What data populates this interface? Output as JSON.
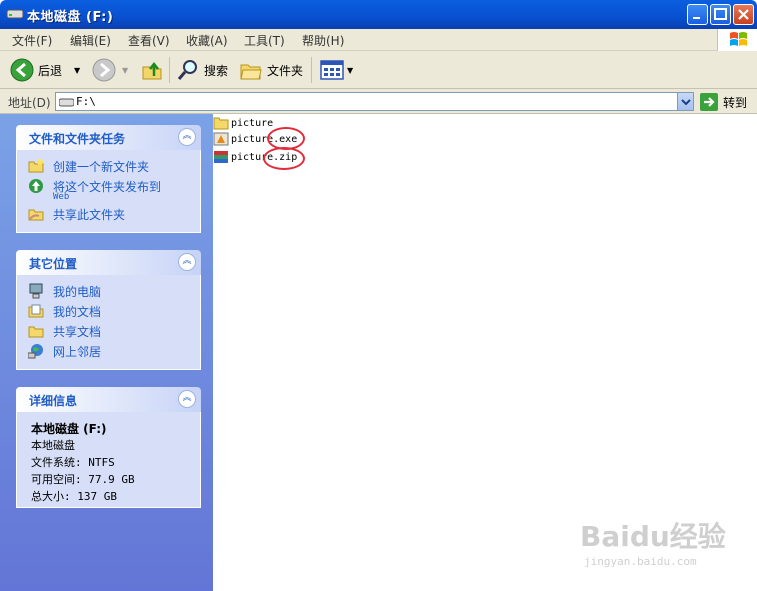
{
  "window": {
    "title": "本地磁盘 (F:)"
  },
  "menu": [
    "文件(F)",
    "编辑(E)",
    "查看(V)",
    "收藏(A)",
    "工具(T)",
    "帮助(H)"
  ],
  "toolbar": {
    "back": "后退",
    "search": "搜索",
    "folders": "文件夹"
  },
  "address": {
    "label": "地址(D)",
    "value": "F:\\",
    "go": "转到"
  },
  "tasks_panel": {
    "title": "文件和文件夹任务",
    "items": [
      {
        "label": "创建一个新文件夹",
        "icon": "new-folder-icon"
      },
      {
        "label": "将这个文件夹发布到",
        "sub": "Web",
        "icon": "publish-web-icon"
      },
      {
        "label": "共享此文件夹",
        "icon": "share-folder-icon"
      }
    ]
  },
  "places_panel": {
    "title": "其它位置",
    "items": [
      {
        "label": "我的电脑",
        "icon": "my-computer-icon"
      },
      {
        "label": "我的文档",
        "icon": "my-documents-icon"
      },
      {
        "label": "共享文档",
        "icon": "shared-documents-icon"
      },
      {
        "label": "网上邻居",
        "icon": "network-places-icon"
      }
    ]
  },
  "details_panel": {
    "title": "详细信息",
    "name": "本地磁盘 (F:)",
    "type": "本地磁盘",
    "filesystem": "文件系统: NTFS",
    "free": "可用空间: 77.9 GB",
    "total": "总大小: 137 GB"
  },
  "files": [
    {
      "name": "picture",
      "icon": "folder-icon"
    },
    {
      "name": "picture.exe",
      "icon": "exe-icon"
    },
    {
      "name": "picture.zip",
      "icon": "zip-icon"
    }
  ],
  "watermark": {
    "logo": "Baidu经验",
    "url": "jingyan.baidu.com"
  },
  "colors": {
    "title_bar": "#0a5fe0",
    "task_pane": "#6375d6",
    "link": "#215dc6",
    "annotation": "#e32b3a"
  }
}
